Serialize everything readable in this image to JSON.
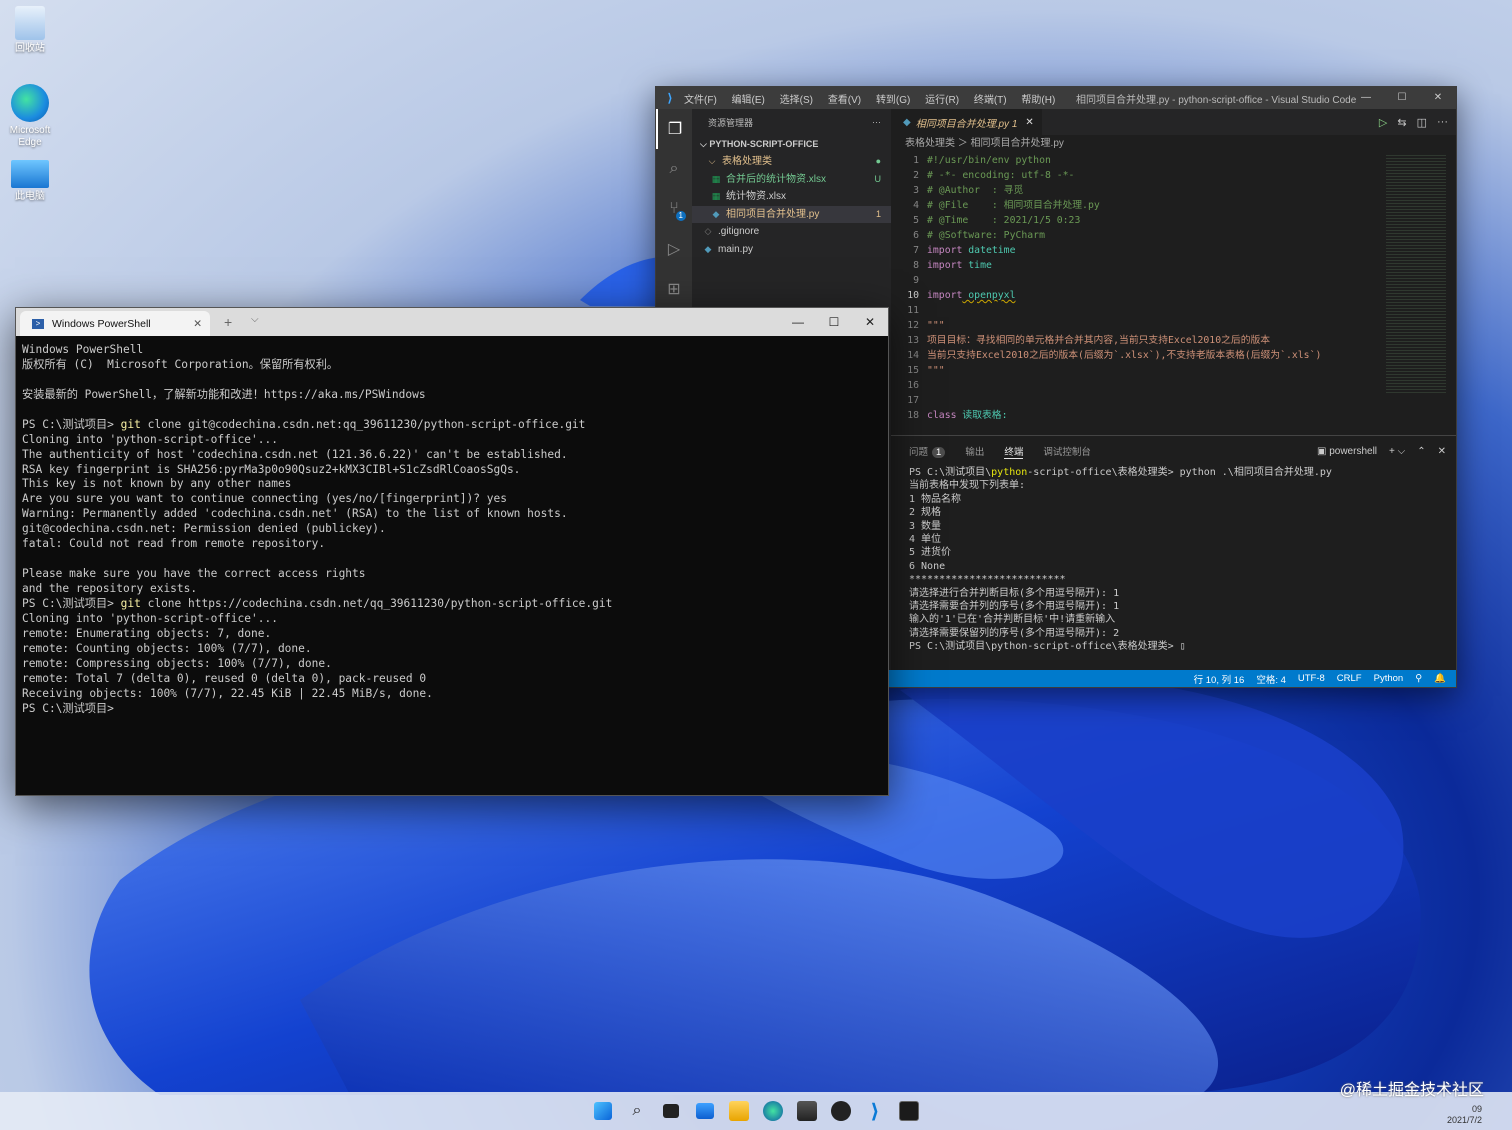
{
  "desktop": {
    "icons": [
      {
        "label": "回收站"
      },
      {
        "label": "Microsoft Edge"
      },
      {
        "label": "此电脑"
      }
    ],
    "watermark": "@稀土掘金技术社区"
  },
  "vscode": {
    "menu": [
      "文件(F)",
      "编辑(E)",
      "选择(S)",
      "查看(V)",
      "转到(G)",
      "运行(R)",
      "终端(T)",
      "帮助(H)"
    ],
    "window_title": "相同项目合并处理.py - python-script-office - Visual Studio Code",
    "explorer_title": "资源管理器",
    "explorer_more": "···",
    "root_folder": "PYTHON-SCRIPT-OFFICE",
    "tree": [
      {
        "label": "表格处理类",
        "status": "●"
      },
      {
        "label": "合并后的统计物资.xlsx",
        "status": "U"
      },
      {
        "label": "统计物资.xlsx",
        "status": ""
      },
      {
        "label": "相同项目合并处理.py",
        "status": "1"
      },
      {
        "label": ".gitignore",
        "status": ""
      },
      {
        "label": "main.py",
        "status": ""
      }
    ],
    "activity_badge": "1",
    "tab_label": "相同项目合并处理.py 1",
    "tab_close": "✕",
    "breadcrumb": "表格处理类 ＞ 相同项目合并处理.py",
    "code_lines": [
      {
        "n": "1",
        "text": "#!/usr/bin/env python"
      },
      {
        "n": "2",
        "text": "# -*- encoding: utf-8 -*-"
      },
      {
        "n": "3",
        "text": "# @Author  : 寻觅"
      },
      {
        "n": "4",
        "text": "# @File    : 相同项目合并处理.py"
      },
      {
        "n": "5",
        "text": "# @Time    : 2021/1/5 0:23"
      },
      {
        "n": "6",
        "text": "# @Software: PyCharm"
      },
      {
        "n": "7",
        "kw": "import",
        "text": " datetime"
      },
      {
        "n": "8",
        "kw": "import",
        "text": " time"
      },
      {
        "n": "9",
        "text": ""
      },
      {
        "n": "10",
        "kw": "import",
        "text": " openpyxl"
      },
      {
        "n": "11",
        "text": ""
      },
      {
        "n": "12",
        "text": "\"\"\""
      },
      {
        "n": "13",
        "text": "项目目标：寻找相同的单元格并合并其内容,当前只支持Excel2010之后的版本"
      },
      {
        "n": "14",
        "text": "当前只支持Excel2010之后的版本(后缀为`.xlsx`),不支持老版本表格(后缀为`.xls`)"
      },
      {
        "n": "15",
        "text": "\"\"\""
      },
      {
        "n": "16",
        "text": ""
      },
      {
        "n": "17",
        "text": ""
      },
      {
        "n": "18",
        "kw": "class",
        "text": " 读取表格:"
      }
    ],
    "panel_tabs": [
      "问题",
      "输出",
      "终端",
      "调试控制台"
    ],
    "problems_count": "1",
    "panel_shell": "powershell",
    "terminal_lines": [
      "PS C:\\测试项目\\python-script-office\\表格处理类> python .\\相同项目合并处理.py",
      "当前表格中发现下列表单:",
      "1 物品名称",
      "2 规格",
      "3 数量",
      "4 单位",
      "5 进货价",
      "6 None",
      "**************************",
      "请选择进行合并判断目标(多个用逗号隔开): 1",
      "请选择需要合并列的序号(多个用逗号隔开): 1",
      "输入的'1'已在'合并判断目标'中!请重新输入",
      "请选择需要保留列的序号(多个用逗号隔开): 2",
      "PS C:\\测试项目\\python-script-office\\表格处理类> ▯"
    ],
    "status": [
      "行 10, 列 16",
      "空格: 4",
      "UTF-8",
      "CRLF",
      "Python",
      "⚲",
      "🔔"
    ]
  },
  "powershell": {
    "tab_title": "Windows PowerShell",
    "new_tab": "+",
    "dropdown": "⌵",
    "lines": [
      {
        "text": "Windows PowerShell"
      },
      {
        "text": "版权所有 (C)  Microsoft Corporation。保留所有权利。"
      },
      {
        "text": ""
      },
      {
        "text": "安装最新的 PowerShell，了解新功能和改进！https://aka.ms/PSWindows"
      },
      {
        "text": ""
      },
      {
        "prompt": "PS C:\\测试项目> ",
        "cmd": "git",
        "text": " clone git@codechina.csdn.net:qq_39611230/python-script-office.git"
      },
      {
        "text": "Cloning into 'python-script-office'..."
      },
      {
        "text": "The authenticity of host 'codechina.csdn.net (121.36.6.22)' can't be established."
      },
      {
        "text": "RSA key fingerprint is SHA256:pyrMa3p0o90Qsuz2+kMX3CIBl+S1cZsdRlCoaosSgQs."
      },
      {
        "text": "This key is not known by any other names"
      },
      {
        "text": "Are you sure you want to continue connecting (yes/no/[fingerprint])? yes"
      },
      {
        "text": "Warning: Permanently added 'codechina.csdn.net' (RSA) to the list of known hosts."
      },
      {
        "text": "git@codechina.csdn.net: Permission denied (publickey)."
      },
      {
        "text": "fatal: Could not read from remote repository."
      },
      {
        "text": ""
      },
      {
        "text": "Please make sure you have the correct access rights"
      },
      {
        "text": "and the repository exists."
      },
      {
        "prompt": "PS C:\\测试项目> ",
        "cmd": "git",
        "text": " clone https://codechina.csdn.net/qq_39611230/python-script-office.git"
      },
      {
        "text": "Cloning into 'python-script-office'..."
      },
      {
        "text": "remote: Enumerating objects: 7, done."
      },
      {
        "text": "remote: Counting objects: 100% (7/7), done."
      },
      {
        "text": "remote: Compressing objects: 100% (7/7), done."
      },
      {
        "text": "remote: Total 7 (delta 0), reused 0 (delta 0), pack-reused 0"
      },
      {
        "text": "Receiving objects: 100% (7/7), 22.45 KiB | 22.45 MiB/s, done."
      },
      {
        "text": "PS C:\\测试项目>"
      }
    ]
  },
  "taskbar": {
    "tray_time": "09",
    "tray_date": "2021/7/2"
  },
  "colors": {
    "vscode_status": "#007acc",
    "ps_bg": "#0c0c0c",
    "accent": "#3ea6ff"
  }
}
